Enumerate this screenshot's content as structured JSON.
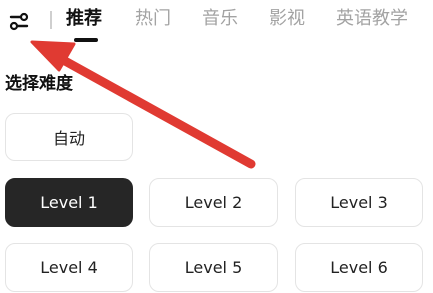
{
  "tabs": [
    {
      "label": "推荐",
      "active": true
    },
    {
      "label": "热门",
      "active": false
    },
    {
      "label": "音乐",
      "active": false
    },
    {
      "label": "影视",
      "active": false
    },
    {
      "label": "英语教学",
      "active": false
    }
  ],
  "filter_icon": "sliders-icon",
  "difficulty": {
    "title": "选择难度",
    "auto_label": "自动",
    "levels": [
      "Level 1",
      "Level 2",
      "Level 3",
      "Level 4",
      "Level 5",
      "Level 6"
    ],
    "selected": "Level 1"
  },
  "annotation": {
    "type": "arrow",
    "color": "#e03a32",
    "points_to": "filter-button"
  }
}
